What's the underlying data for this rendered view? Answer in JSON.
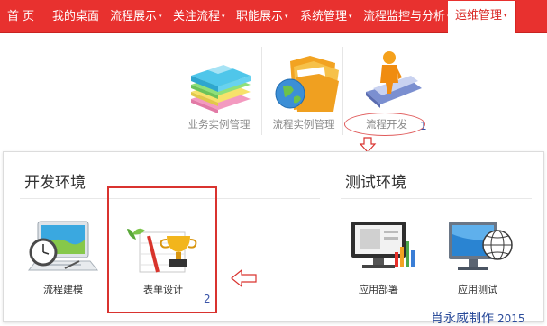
{
  "nav": {
    "items": [
      {
        "label": "首 页",
        "dropdown": false
      },
      {
        "label": "我的桌面",
        "dropdown": false
      },
      {
        "label": "流程展示",
        "dropdown": true
      },
      {
        "label": "关注流程",
        "dropdown": true
      },
      {
        "label": "职能展示",
        "dropdown": true
      },
      {
        "label": "系统管理",
        "dropdown": true
      },
      {
        "label": "流程监控与分析",
        "dropdown": true
      },
      {
        "label": "运维管理",
        "dropdown": true,
        "active": true
      }
    ],
    "caret": "▾"
  },
  "modules": [
    {
      "label": "业务实例管理",
      "icon": "business-instance-icon"
    },
    {
      "label": "流程实例管理",
      "icon": "process-instance-icon"
    },
    {
      "label": "流程开发",
      "icon": "process-development-icon"
    }
  ],
  "annotations": {
    "step1": "1",
    "step2": "2"
  },
  "dev_section": {
    "title": "开发环境",
    "tools": [
      {
        "label": "流程建模",
        "icon": "process-modeling-icon"
      },
      {
        "label": "表单设计",
        "icon": "form-design-icon"
      }
    ]
  },
  "test_section": {
    "title": "测试环境",
    "tools": [
      {
        "label": "应用部署",
        "icon": "app-deploy-icon"
      },
      {
        "label": "应用测试",
        "icon": "app-test-icon"
      }
    ]
  },
  "footer": {
    "author": "肖永威制作",
    "year": "2015"
  },
  "colors": {
    "nav_bg": "#e8312f",
    "annotation_red": "#d9332f",
    "annotation_blue": "#3a54a8"
  }
}
